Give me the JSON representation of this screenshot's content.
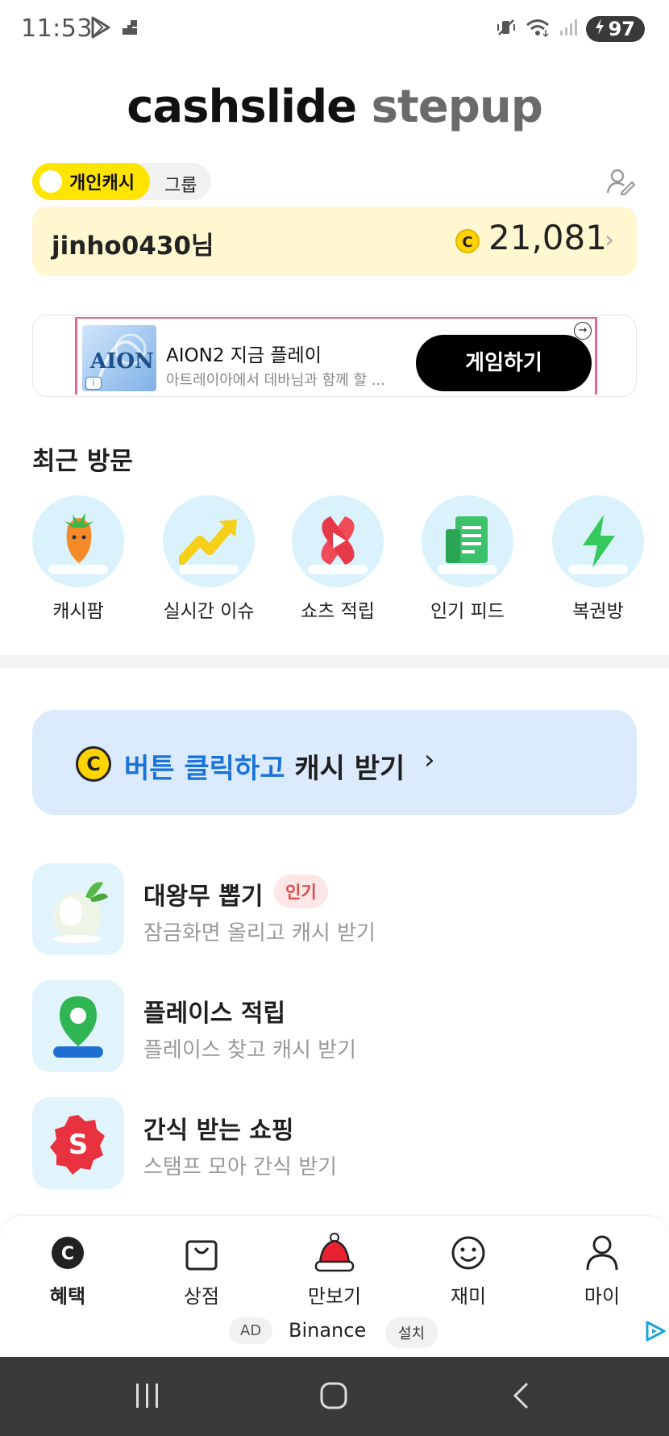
{
  "status_bar": {
    "time": "11:53",
    "battery": "97",
    "icons": [
      "play-store-icon",
      "signal-corner-icon",
      "mute-vibrate-icon",
      "wifi-icon",
      "cell-signal-icon",
      "battery-charging-icon"
    ]
  },
  "header": {
    "logo_primary": "cashslide",
    "logo_secondary": "stepup"
  },
  "mode_toggle": {
    "active": "개인캐시",
    "inactive": "그룹"
  },
  "cash_card": {
    "username": "jinho0430님",
    "coin_symbol": "C",
    "amount": "21,081",
    "chevron": "›"
  },
  "ad_banner": {
    "thumb_text": "AION",
    "info": "i",
    "title": "AION2 지금 플레이",
    "subtitle": "아트레이아에서 데바님과 함께 할 ...",
    "button": "게임하기",
    "choice": "→"
  },
  "recent": {
    "title": "최근 방문",
    "items": [
      {
        "label": "캐시팜",
        "icon": "carrot-icon"
      },
      {
        "label": "실시간 이슈",
        "icon": "trend-arrow-icon"
      },
      {
        "label": "쇼츠 적립",
        "icon": "shorts-play-icon"
      },
      {
        "label": "인기 피드",
        "icon": "feed-doc-icon"
      },
      {
        "label": "복권방",
        "icon": "lightning-icon"
      }
    ]
  },
  "cash_button": {
    "coin": "C",
    "text_blue": "버튼 클릭하고",
    "text_dark": "캐시 받기",
    "chevron": "›"
  },
  "features": [
    {
      "title": "대왕무 뽑기",
      "badge": "인기",
      "subtitle": "잠금화면 올리고 캐시 받기",
      "icon": "radish-icon"
    },
    {
      "title": "플레이스 적립",
      "subtitle": "플레이스 찾고 캐시 받기",
      "icon": "map-pin-icon"
    },
    {
      "title": "간식 받는 쇼핑",
      "subtitle": "스탬프 모아 간식 받기",
      "icon": "shopping-s-icon"
    }
  ],
  "bottom_nav": {
    "items": [
      {
        "label": "혜택",
        "icon": "coin-c-icon",
        "active": true
      },
      {
        "label": "상점",
        "icon": "shopping-bag-icon",
        "active": false
      },
      {
        "label": "만보기",
        "icon": "santa-hat-icon",
        "active": false
      },
      {
        "label": "재미",
        "icon": "smile-icon",
        "active": false
      },
      {
        "label": "마이",
        "icon": "person-icon",
        "active": false
      }
    ],
    "ad_label": "AD",
    "ad_name": "Binance",
    "install_label": "설치"
  },
  "colors": {
    "accent_yellow": "#ffe400",
    "cash_card_bg": "#fff7cf",
    "cash_button_bg": "#dbeafc",
    "link_blue": "#1a73d9",
    "badge_red": "#e04b4b"
  }
}
